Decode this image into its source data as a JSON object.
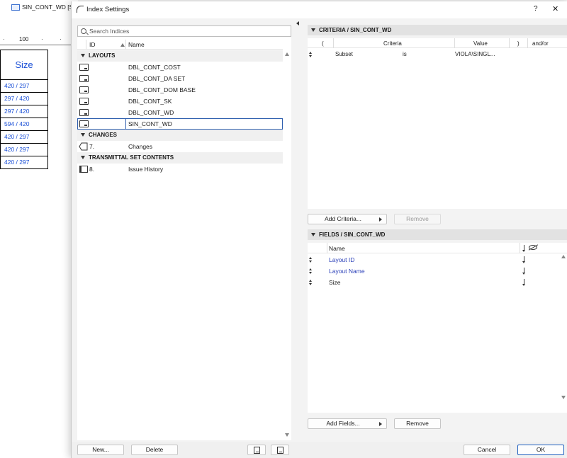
{
  "background_app": {
    "tab_title": "SIN_CONT_WD [S",
    "ruler_label": "100",
    "table": {
      "header": "Size",
      "rows": [
        "420 / 297",
        "297 / 420",
        "297 / 420",
        "594 / 420",
        "420 / 297",
        "420 / 297",
        "420 / 297"
      ]
    }
  },
  "dialog": {
    "title": "Index Settings",
    "help_label": "?",
    "close_label": "✕"
  },
  "left_panel": {
    "search_placeholder": "Search Indices",
    "columns": {
      "id": "ID",
      "name": "Name"
    },
    "groups": [
      {
        "label": "LAYOUTS",
        "items": [
          {
            "id": "",
            "name": "DBL_CONT_COST"
          },
          {
            "id": "",
            "name": "DBL_CONT_DA SET"
          },
          {
            "id": "",
            "name": "DBL_CONT_DOM BASE"
          },
          {
            "id": "",
            "name": "DBL_CONT_SK"
          },
          {
            "id": "",
            "name": "DBL_CONT_WD"
          },
          {
            "id": "",
            "name": "SIN_CONT_WD"
          }
        ]
      },
      {
        "label": "CHANGES",
        "items": [
          {
            "id": "7.",
            "name": "Changes"
          }
        ]
      },
      {
        "label": "TRANSMITTAL SET CONTENTS",
        "items": [
          {
            "id": "8.",
            "name": "Issue History"
          }
        ]
      }
    ],
    "selected_item": "SIN_CONT_WD"
  },
  "criteria": {
    "header": "CRITERIA / SIN_CONT_WD",
    "columns": {
      "open_paren": "(",
      "criteria": "Criteria",
      "value": "Value",
      "close_paren": ")",
      "andor": "and/or"
    },
    "rows": [
      {
        "criteria": "Subset",
        "operator": "is",
        "value": "VIOLA\\SINGL..."
      }
    ],
    "add_button": "Add Criteria...",
    "remove_button": "Remove"
  },
  "fields": {
    "header": "FIELDS / SIN_CONT_WD",
    "column_name": "Name",
    "rows": [
      {
        "name": "Layout ID",
        "linked": true
      },
      {
        "name": "Layout Name",
        "linked": true
      },
      {
        "name": "Size",
        "linked": false
      }
    ],
    "add_button": "Add Fields...",
    "remove_button": "Remove"
  },
  "footer": {
    "new_button": "New...",
    "delete_button": "Delete",
    "cancel_button": "Cancel",
    "ok_button": "OK"
  },
  "colors": {
    "accent": "#1f5fbf",
    "link_text": "#2a3fb8",
    "selection_outline": "#2f5fae"
  }
}
